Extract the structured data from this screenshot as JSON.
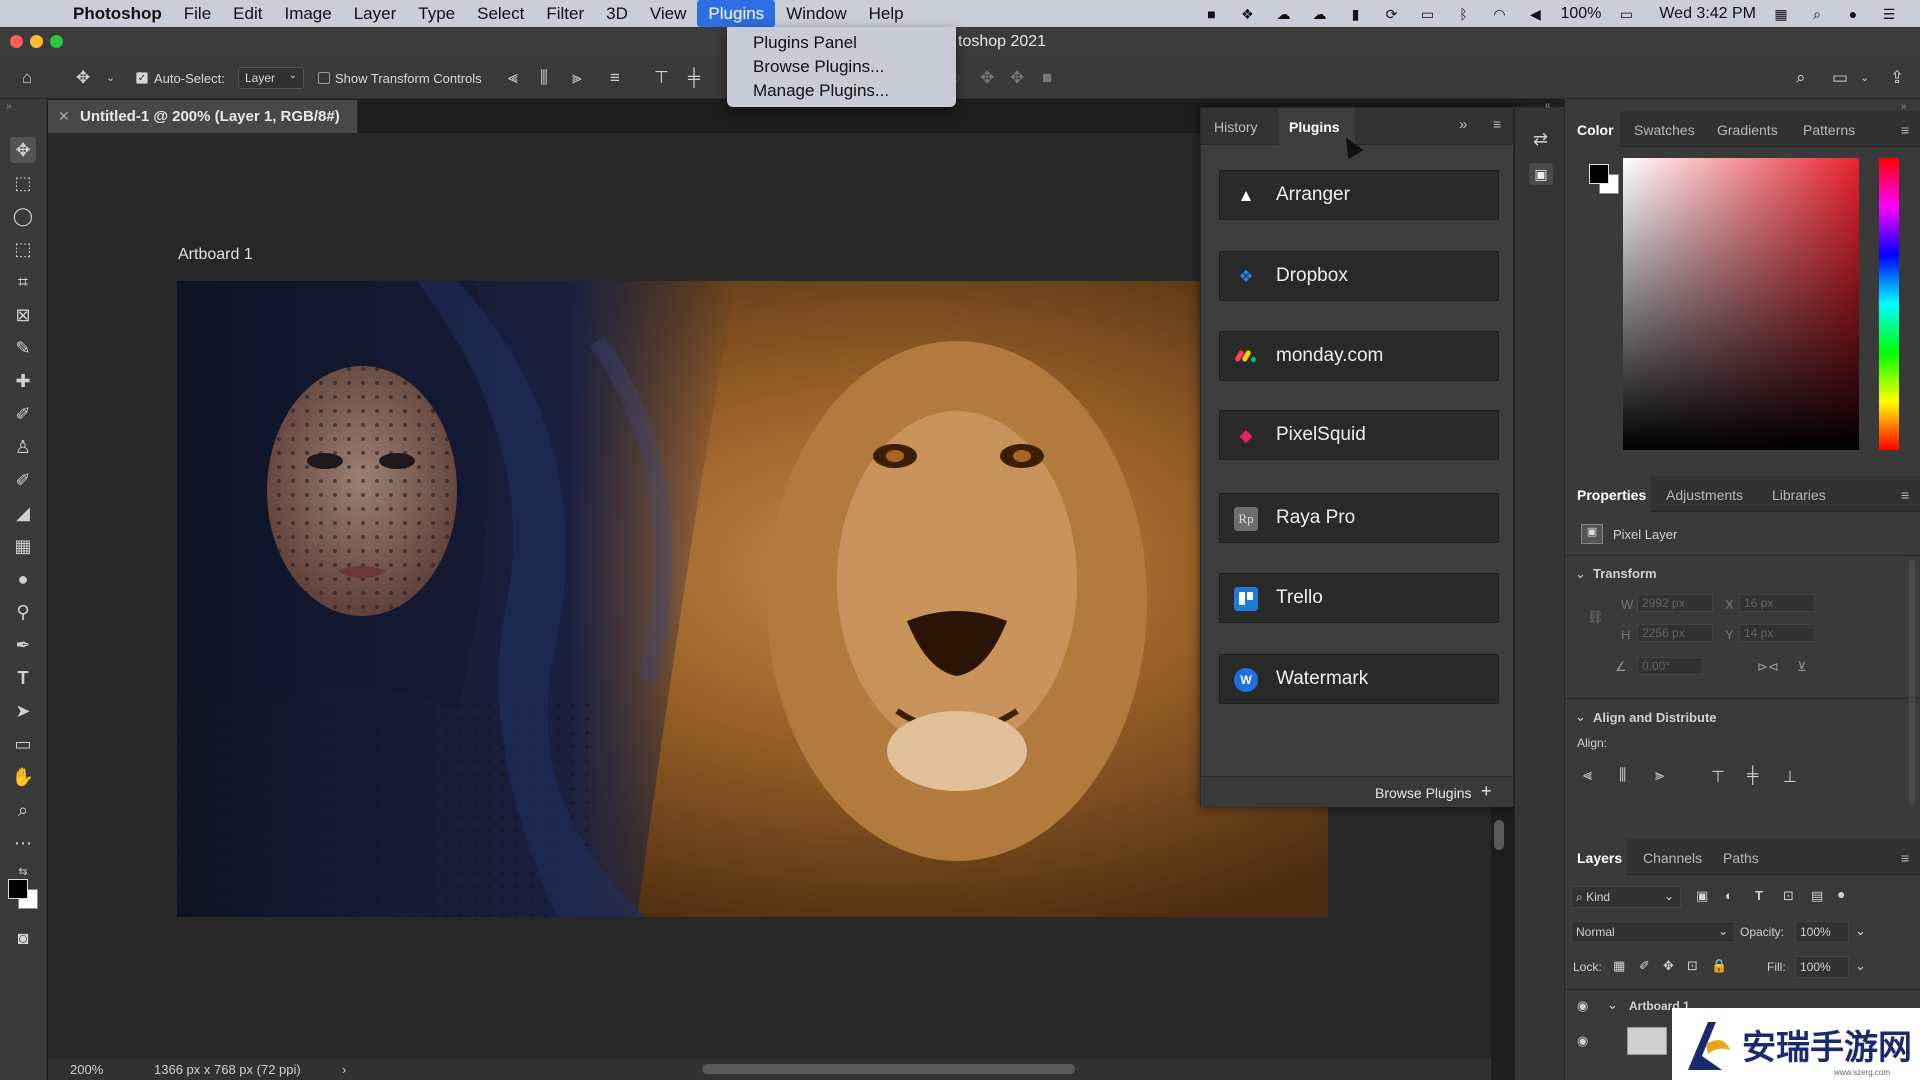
{
  "menubar": {
    "app_name": "Photoshop",
    "items": [
      "File",
      "Edit",
      "Image",
      "Layer",
      "Type",
      "Select",
      "Filter",
      "3D",
      "View",
      "Plugins",
      "Window",
      "Help"
    ],
    "battery": "100%",
    "clock": "Wed 3:42 PM"
  },
  "window": {
    "title_fragment": "toshop 2021"
  },
  "plugins_menu": {
    "items": [
      "Plugins Panel",
      "Browse Plugins...",
      "Manage Plugins..."
    ]
  },
  "options_bar": {
    "auto_select_label": "Auto-Select:",
    "auto_select_value": "Layer",
    "show_transform_label": "Show Transform Controls"
  },
  "document": {
    "tab_title": "Untitled-1 @ 200% (Layer 1, RGB/8#)",
    "artboard_label": "Artboard 1",
    "zoom": "200%",
    "doc_info": "1366 px x 768 px (72 ppi)"
  },
  "plugins_panel": {
    "tabs": [
      "History",
      "Plugins"
    ],
    "plugins": [
      {
        "name": "Arranger",
        "icon": "arranger-icon",
        "color": "#ffffff"
      },
      {
        "name": "Dropbox",
        "icon": "dropbox-icon",
        "color": "#2f7de1"
      },
      {
        "name": "monday.com",
        "icon": "monday-icon",
        "color": "#ff3d57"
      },
      {
        "name": "PixelSquid",
        "icon": "pixelsquid-icon",
        "color": "#e0245e"
      },
      {
        "name": "Raya Pro",
        "icon": "raya-pro-icon",
        "color": "#8a8a8a"
      },
      {
        "name": "Trello",
        "icon": "trello-icon",
        "color": "#1f7bd8"
      },
      {
        "name": "Watermark",
        "icon": "watermark-icon",
        "color": "#1f6fe0"
      }
    ],
    "browse_label": "Browse Plugins"
  },
  "color_panel": {
    "tabs": [
      "Color",
      "Swatches",
      "Gradients",
      "Patterns"
    ]
  },
  "properties_panel": {
    "tabs": [
      "Properties",
      "Adjustments",
      "Libraries"
    ],
    "layer_kind": "Pixel Layer",
    "transform_label": "Transform",
    "w_label": "W",
    "w_value": "2992 px",
    "x_label": "X",
    "x_value": "16 px",
    "h_label": "H",
    "h_value": "2256 px",
    "y_label": "Y",
    "y_value": "14 px",
    "angle_value": "0.00°",
    "align_label": "Align and Distribute",
    "align_sub": "Align:"
  },
  "layers_panel": {
    "tabs": [
      "Layers",
      "Channels",
      "Paths"
    ],
    "filter_kind": "Kind",
    "blend_mode": "Normal",
    "opacity_label": "Opacity:",
    "opacity_value": "100%",
    "lock_label": "Lock:",
    "fill_label": "Fill:",
    "fill_value": "100%",
    "layers": [
      "Artboard 1"
    ]
  },
  "watermark": {
    "text": "安瑞手游网",
    "url": "www.szerg.com"
  }
}
